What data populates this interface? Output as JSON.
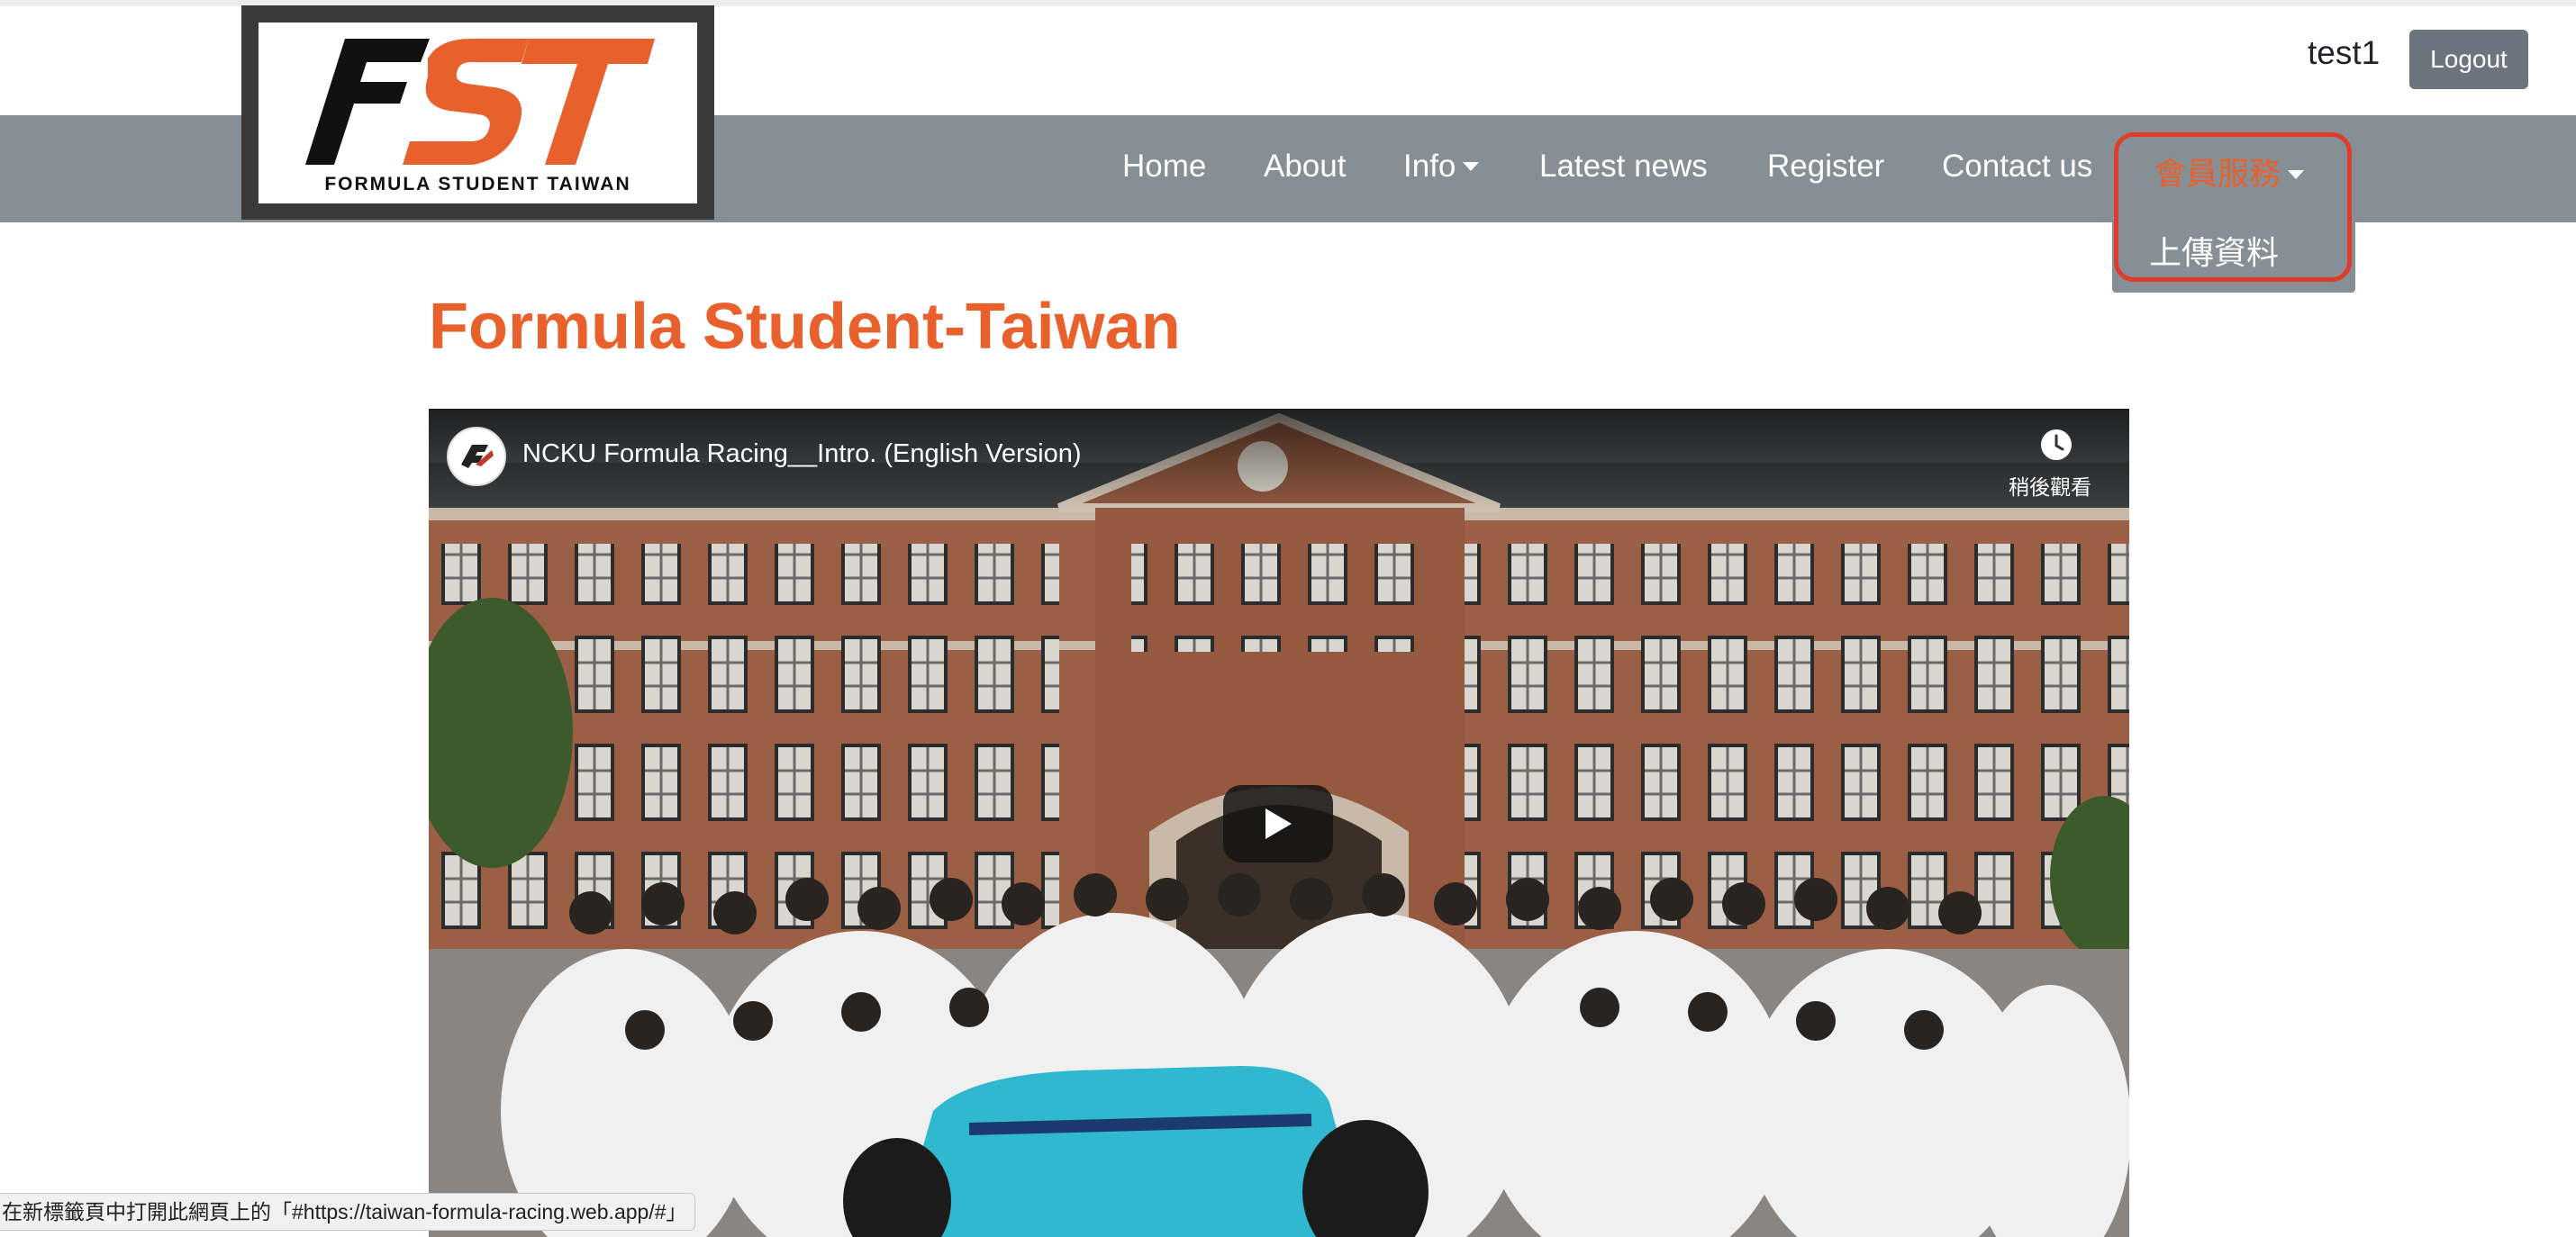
{
  "header": {
    "username": "test1",
    "logout_label": "Logout"
  },
  "logo": {
    "caption": "FORMULA STUDENT TAIWAN",
    "letters": "FST"
  },
  "nav": {
    "home": "Home",
    "about": "About",
    "info": "Info",
    "latest_news": "Latest news",
    "register": "Register",
    "contact": "Contact us",
    "member_services": "會員服務",
    "dropdown": {
      "upload": "上傳資料"
    }
  },
  "main": {
    "title": "Formula Student-Taiwan"
  },
  "video": {
    "title": "NCKU Formula Racing__Intro. (English Version)",
    "watch_later": "稍後觀看"
  },
  "status_bar": {
    "text": "在新標籤頁中打開此網頁上的「#https://taiwan-formula-racing.web.app/#」"
  },
  "colors": {
    "accent": "#e8602c",
    "navbar": "#868e96",
    "logout_button": "#6c757d",
    "highlight": "#e03c2c"
  }
}
